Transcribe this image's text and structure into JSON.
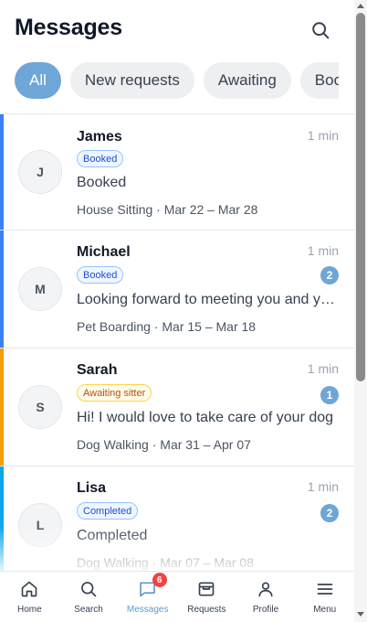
{
  "header": {
    "title": "Messages"
  },
  "filters": [
    {
      "label": "All",
      "active": true
    },
    {
      "label": "New requests",
      "active": false
    },
    {
      "label": "Awaiting",
      "active": false
    },
    {
      "label": "Booked",
      "active": false
    }
  ],
  "conversations": [
    {
      "initial": "J",
      "name": "James",
      "time": "1 min",
      "status": "Booked",
      "unread": "",
      "preview": "Booked",
      "meta": "House Sitting · Mar 22 – Mar 28",
      "color": "#3b82f6"
    },
    {
      "initial": "M",
      "name": "Michael",
      "time": "1 min",
      "status": "Booked",
      "unread": "2",
      "preview": "Looking forward to meeting you and your pet!",
      "meta": "Pet Boarding · Mar 15 – Mar 18",
      "color": "#3b82f6"
    },
    {
      "initial": "S",
      "name": "Sarah",
      "time": "1 min",
      "status": "Awaiting sitter",
      "unread": "1",
      "preview": "Hi! I would love to take care of your dog",
      "meta": "Dog Walking · Mar 31 – Apr 07",
      "color": "#f59e0b"
    },
    {
      "initial": "L",
      "name": "Lisa",
      "time": "1 min",
      "status": "Completed",
      "unread": "2",
      "preview": "Completed",
      "meta": "Dog Walking · Mar 07 – Mar 08",
      "color": "#0ea5e9"
    }
  ],
  "nav": [
    {
      "label": "Home",
      "icon": "home-icon"
    },
    {
      "label": "Search",
      "icon": "search-icon"
    },
    {
      "label": "Messages",
      "icon": "chat-icon",
      "badge": "6",
      "active": true
    },
    {
      "label": "Requests",
      "icon": "inbox-icon"
    },
    {
      "label": "Profile",
      "icon": "user-icon"
    },
    {
      "label": "Menu",
      "icon": "menu-icon"
    }
  ],
  "colors": {
    "accent": "#6fa6d8",
    "badge_red": "#ef4444"
  }
}
